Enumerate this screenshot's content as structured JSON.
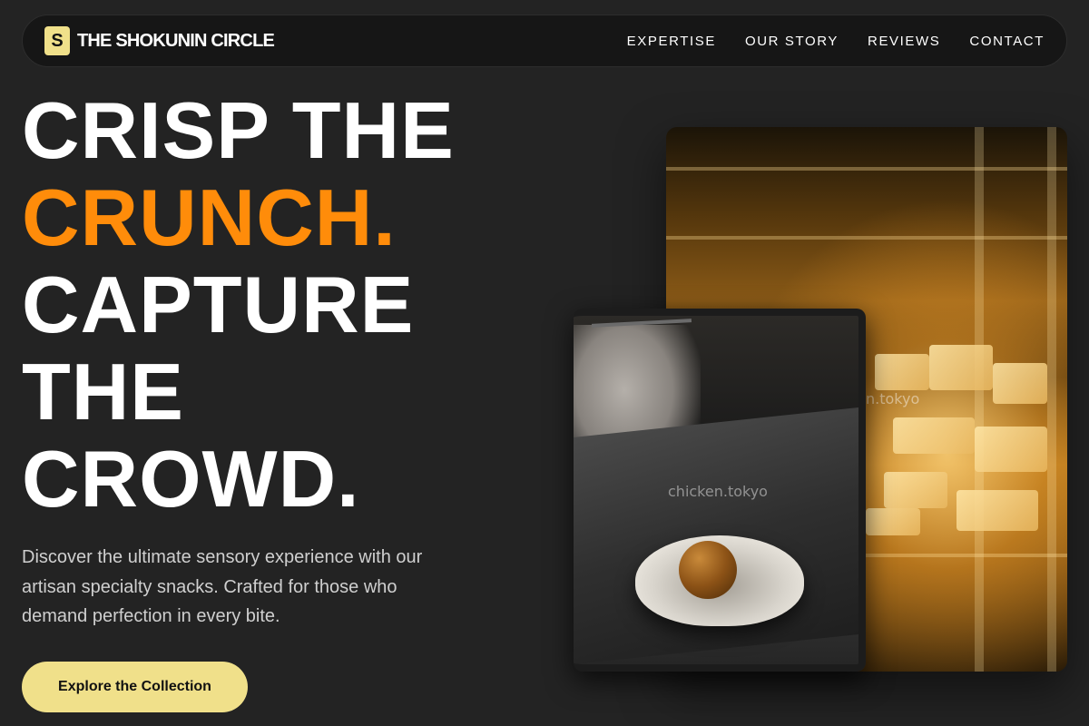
{
  "brand": {
    "mark": "S",
    "name": "THE SHOKUNIN CIRCLE"
  },
  "nav": {
    "links": [
      "EXPERTISE",
      "OUR STORY",
      "REVIEWS",
      "CONTACT"
    ]
  },
  "hero": {
    "headline": {
      "line1": "CRISP THE",
      "line2": "CRUNCH.",
      "line3": "CAPTURE",
      "line4": "THE",
      "line5": "CROWD."
    },
    "subtext": "Discover the ultimate sensory experience with our artisan specialty snacks. Crafted for those who demand perfection in every bite.",
    "cta_label": "Explore the Collection"
  },
  "images": {
    "front_watermark": "chicken.tokyo",
    "back_watermark": "n.tokyo"
  },
  "colors": {
    "background": "#232323",
    "accent": "#ff8c0a",
    "cta": "#f0e08a"
  }
}
